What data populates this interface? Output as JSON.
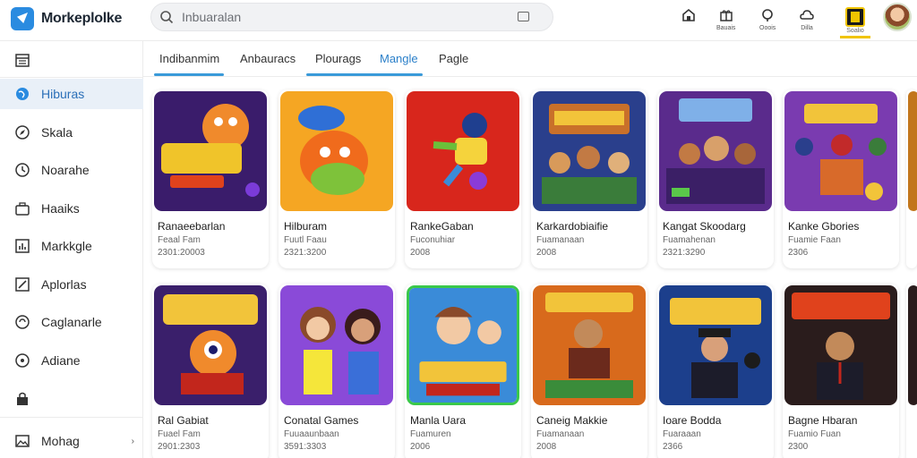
{
  "app": {
    "name": "Morkeplolke"
  },
  "search": {
    "value": "",
    "placeholder": "Inbuaralan"
  },
  "header_icons": [
    {
      "name": "home-icon",
      "label": ""
    },
    {
      "name": "gift-icon",
      "label": "Bauais"
    },
    {
      "name": "notification-icon",
      "label": "Ooois"
    },
    {
      "name": "cloud-icon",
      "label": "Dilla"
    },
    {
      "name": "badge-icon",
      "label": "Soalio"
    }
  ],
  "sidebar": {
    "items": [
      {
        "label": "",
        "icon": "calendar-icon"
      },
      {
        "label": "Hiburas",
        "icon": "globe-icon",
        "active": true
      },
      {
        "label": "Skala",
        "icon": "compass-icon"
      },
      {
        "label": "Noarahe",
        "icon": "clock-icon"
      },
      {
        "label": "Haaiks",
        "icon": "briefcase-icon"
      },
      {
        "label": "Markkgle",
        "icon": "chart-icon"
      },
      {
        "label": "Aplorlas",
        "icon": "edit-icon"
      },
      {
        "label": "Caglanarle",
        "icon": "sync-icon"
      },
      {
        "label": "Adiane",
        "icon": "help-icon"
      },
      {
        "label": "",
        "icon": "bag-icon"
      },
      {
        "label": "Mohag",
        "icon": "image-icon",
        "more": "›"
      }
    ]
  },
  "tabs": [
    {
      "label": "Indibanmim",
      "active": true
    },
    {
      "label": "Anbauracs"
    },
    {
      "label": "Plourags",
      "active": true
    },
    {
      "label": "Mangle",
      "accent": true
    },
    {
      "label": "Pagle"
    }
  ],
  "colors": {
    "accent": "#2a8be0",
    "active_bg": "#e9f0f8",
    "tab_accent": "#3a9ad9"
  },
  "cards": [
    {
      "title": "Ranaeebarlan",
      "sub": "Feaal Fam",
      "meta": "2301:20003",
      "art": "orange-character"
    },
    {
      "title": "Hilburam",
      "sub": "Fuutl Faau",
      "meta": "2321:3200",
      "art": "blue-hat-character"
    },
    {
      "title": "RankeGaban",
      "sub": "Fuconuhiar",
      "meta": "2008",
      "art": "red-jumping-character"
    },
    {
      "title": "Karkardobiaifie",
      "sub": "Fuamanaan",
      "meta": "2008",
      "art": "castle-crowd"
    },
    {
      "title": "Kangat Skoodarg",
      "sub": "Fuamahenan",
      "meta": "2321:3290",
      "art": "purple-crowd"
    },
    {
      "title": "Kanke Gbories",
      "sub": "Fuamie Faan",
      "meta": "2306",
      "art": "dancers"
    },
    {
      "title": "Ral Gabiat",
      "sub": "Fuael Fam",
      "meta": "2901:2303",
      "art": "gaming-monster"
    },
    {
      "title": "Conatal Games",
      "sub": "Fuuaaunbaan",
      "meta": "3591:3303",
      "art": "girls"
    },
    {
      "title": "Manla Uara",
      "sub": "Fuamuren",
      "meta": "2006",
      "art": "mascot-boys"
    },
    {
      "title": "Caneig Makkie",
      "sub": "Fuamanaan",
      "meta": "2008",
      "art": "carnival-man"
    },
    {
      "title": "Ioare Bodda",
      "sub": "Fuaraaan",
      "meta": "2366",
      "art": "suited-man"
    },
    {
      "title": "Bagne Hbaran",
      "sub": "Fuamio Fuan",
      "meta": "2300",
      "art": "businessman"
    }
  ]
}
